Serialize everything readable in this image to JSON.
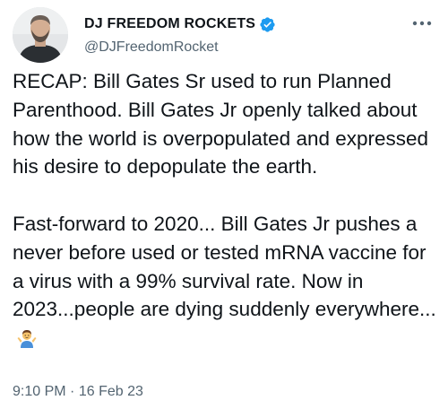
{
  "tweet": {
    "display_name": "DJ FREEDOM ROCKETS",
    "handle": "@DJFreedomRocket",
    "verified": true,
    "icons": {
      "verified": "verified-badge-icon",
      "more": "more-options-icon",
      "emoji": "person-shrugging-emoji"
    },
    "paragraph_1": "RECAP: Bill Gates Sr used to run Planned Parenthood. Bill Gates Jr openly talked about how the world is overpopulated and expressed his desire to depopulate the earth.",
    "paragraph_2": "Fast-forward to 2020... Bill Gates Jr pushes a never before used or tested mRNA vaccine for a virus with a 99% survival rate. Now in 2023...people are dying suddenly everywhere...",
    "time": "9:10 PM",
    "separator": "·",
    "date": "16 Feb 23"
  },
  "colors": {
    "text": "#0f1419",
    "secondary": "#536471",
    "verified_blue": "#1d9bf0",
    "background": "#ffffff"
  }
}
